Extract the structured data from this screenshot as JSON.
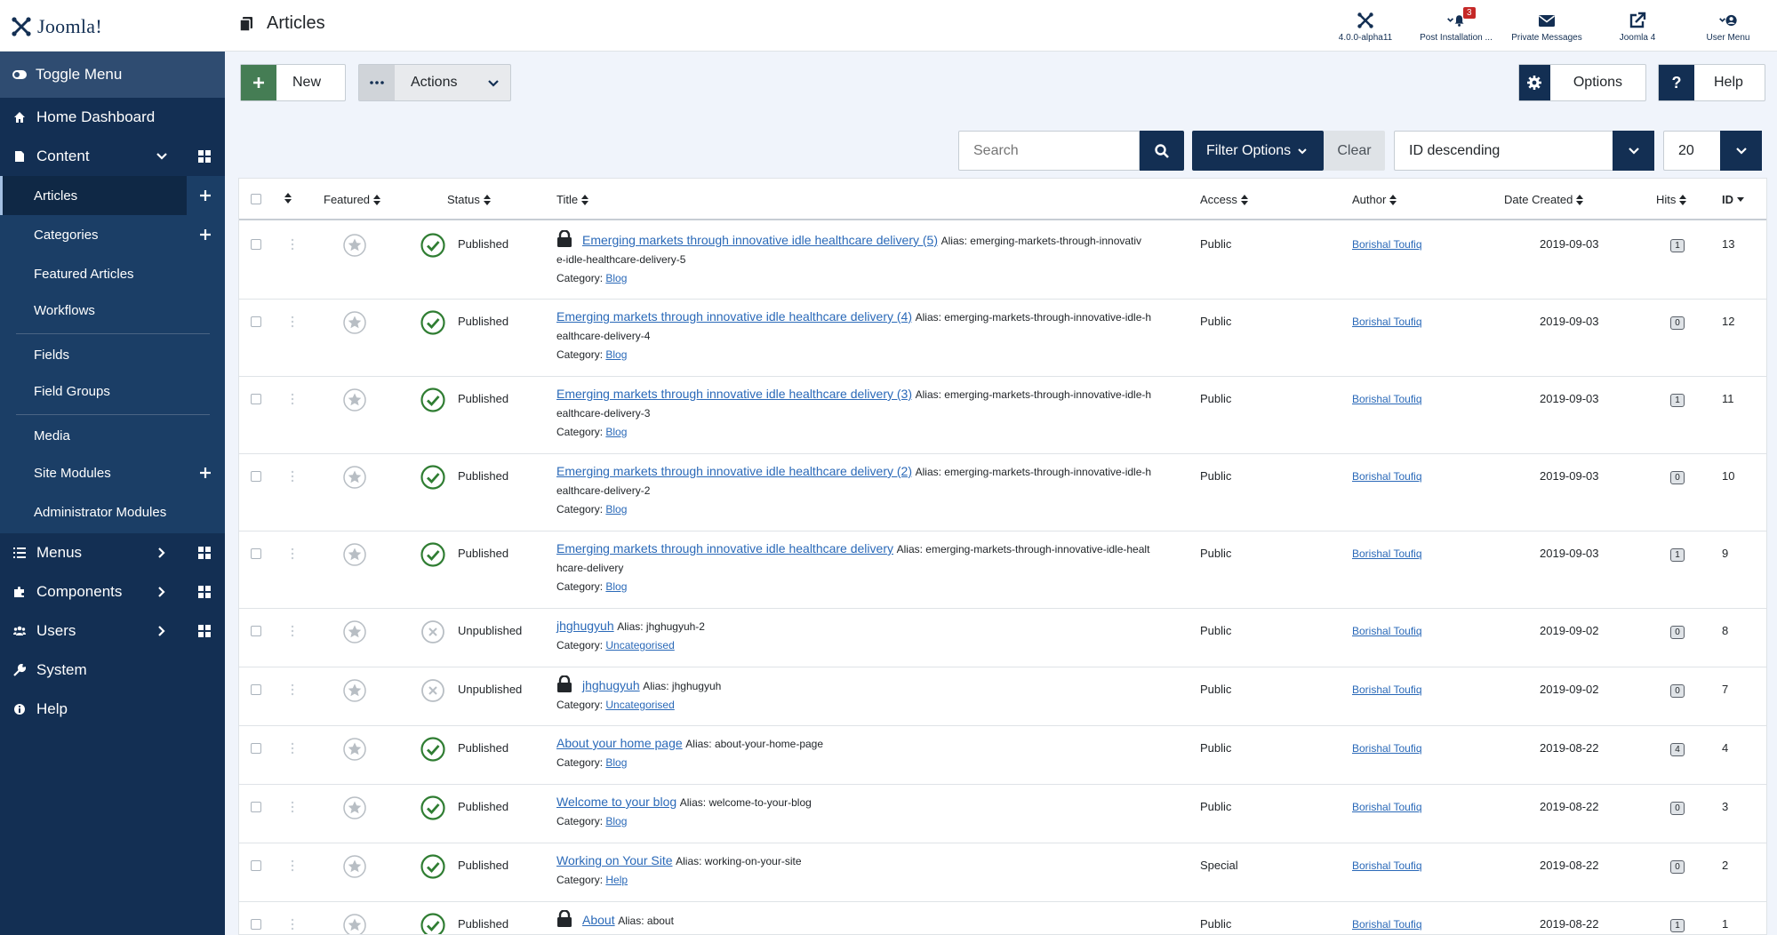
{
  "header": {
    "logo_text": "Joomla!",
    "page_title": "Articles",
    "items": [
      {
        "label": "4.0.0-alpha11",
        "icon": "joomla-icon"
      },
      {
        "label": "Post Installation ...",
        "icon": "bell-icon",
        "badge": "3"
      },
      {
        "label": "Private Messages",
        "icon": "envelope-icon"
      },
      {
        "label": "Joomla 4",
        "icon": "external-link-icon"
      },
      {
        "label": "User Menu",
        "icon": "user-icon"
      }
    ]
  },
  "sidebar": {
    "toggle": "Toggle Menu",
    "home": "Home Dashboard",
    "content": "Content",
    "content_items": [
      "Articles",
      "Categories",
      "Featured Articles",
      "Workflows",
      "Fields",
      "Field Groups",
      "Media",
      "Site Modules",
      "Administrator Modules"
    ],
    "menus": "Menus",
    "components": "Components",
    "users": "Users",
    "system": "System",
    "help": "Help"
  },
  "toolbar": {
    "new": "New",
    "actions": "Actions",
    "options": "Options",
    "help": "Help"
  },
  "filters": {
    "search_placeholder": "Search",
    "filter_options": "Filter Options",
    "clear": "Clear",
    "ordering": "ID descending",
    "limit": "20"
  },
  "table": {
    "headers": {
      "featured": "Featured",
      "status": "Status",
      "title": "Title",
      "access": "Access",
      "author": "Author",
      "date": "Date Created",
      "hits": "Hits",
      "id": "ID"
    },
    "rows": [
      {
        "status": "Published",
        "locked": true,
        "title": "Emerging markets through innovative idle healthcare delivery (5)",
        "alias_line1": "Alias: emerging-markets-through-innovativ",
        "alias_line2": "e-idle-healthcare-delivery-5",
        "category_label": "Category:",
        "category": "Blog",
        "access": "Public",
        "author": "Borishal Toufiq",
        "date": "2019-09-03",
        "hits": "1",
        "id": "13"
      },
      {
        "status": "Published",
        "locked": false,
        "title": "Emerging markets through innovative idle healthcare delivery (4)",
        "alias_line1": "Alias: emerging-markets-through-innovative-idle-h",
        "alias_line2": "ealthcare-delivery-4",
        "category_label": "Category:",
        "category": "Blog",
        "access": "Public",
        "author": "Borishal Toufiq",
        "date": "2019-09-03",
        "hits": "0",
        "id": "12"
      },
      {
        "status": "Published",
        "locked": false,
        "title": "Emerging markets through innovative idle healthcare delivery (3)",
        "alias_line1": "Alias: emerging-markets-through-innovative-idle-h",
        "alias_line2": "ealthcare-delivery-3",
        "category_label": "Category:",
        "category": "Blog",
        "access": "Public",
        "author": "Borishal Toufiq",
        "date": "2019-09-03",
        "hits": "1",
        "id": "11"
      },
      {
        "status": "Published",
        "locked": false,
        "title": "Emerging markets through innovative idle healthcare delivery (2)",
        "alias_line1": "Alias: emerging-markets-through-innovative-idle-h",
        "alias_line2": "ealthcare-delivery-2",
        "category_label": "Category:",
        "category": "Blog",
        "access": "Public",
        "author": "Borishal Toufiq",
        "date": "2019-09-03",
        "hits": "0",
        "id": "10"
      },
      {
        "status": "Published",
        "locked": false,
        "title": "Emerging markets through innovative idle healthcare delivery",
        "alias_line1": "Alias: emerging-markets-through-innovative-idle-healt",
        "alias_line2": "hcare-delivery",
        "category_label": "Category:",
        "category": "Blog",
        "access": "Public",
        "author": "Borishal Toufiq",
        "date": "2019-09-03",
        "hits": "1",
        "id": "9"
      },
      {
        "status": "Unpublished",
        "locked": false,
        "title": "jhghugyuh",
        "alias_line1": "Alias: jhghugyuh-2",
        "alias_line2": "",
        "category_label": "Category:",
        "category": "Uncategorised",
        "access": "Public",
        "author": "Borishal Toufiq",
        "date": "2019-09-02",
        "hits": "0",
        "id": "8"
      },
      {
        "status": "Unpublished",
        "locked": true,
        "title": "jhghugyuh",
        "alias_line1": "Alias: jhghugyuh",
        "alias_line2": "",
        "category_label": "Category:",
        "category": "Uncategorised",
        "access": "Public",
        "author": "Borishal Toufiq",
        "date": "2019-09-02",
        "hits": "0",
        "id": "7"
      },
      {
        "status": "Published",
        "locked": false,
        "title": "About your home page",
        "alias_line1": "Alias: about-your-home-page",
        "alias_line2": "",
        "category_label": "Category:",
        "category": "Blog",
        "access": "Public",
        "author": "Borishal Toufiq",
        "date": "2019-08-22",
        "hits": "4",
        "id": "4"
      },
      {
        "status": "Published",
        "locked": false,
        "title": "Welcome to your blog",
        "alias_line1": "Alias: welcome-to-your-blog",
        "alias_line2": "",
        "category_label": "Category:",
        "category": "Blog",
        "access": "Public",
        "author": "Borishal Toufiq",
        "date": "2019-08-22",
        "hits": "0",
        "id": "3"
      },
      {
        "status": "Published",
        "locked": false,
        "title": "Working on Your Site",
        "alias_line1": "Alias: working-on-your-site",
        "alias_line2": "",
        "category_label": "Category:",
        "category": "Help",
        "access": "Special",
        "author": "Borishal Toufiq",
        "date": "2019-08-22",
        "hits": "0",
        "id": "2"
      },
      {
        "status": "Published",
        "locked": true,
        "title": "About",
        "alias_line1": "Alias: about",
        "alias_line2": "",
        "category_label": "",
        "category": "",
        "access": "Public",
        "author": "Borishal Toufiq",
        "date": "2019-08-22",
        "hits": "1",
        "id": "1"
      }
    ]
  },
  "colors": {
    "sidebar_bg": "#132f53",
    "sidebar_toggle_bg": "#2f4c71",
    "new_green": "#457d54",
    "dark_blue": "#132f53",
    "link_blue": "#2a69b8",
    "published_green": "#2f7d32"
  }
}
